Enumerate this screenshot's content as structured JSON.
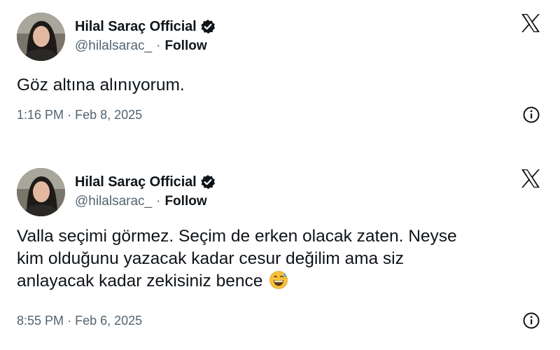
{
  "tweets": [
    {
      "author_name": "Hilal Saraç Official",
      "handle": "@hilalsarac_",
      "separator": "·",
      "follow_label": "Follow",
      "text": "Göz altına alınıyorum.",
      "time": "1:16 PM",
      "date": "Feb 8, 2025"
    },
    {
      "author_name": "Hilal Saraç Official",
      "handle": "@hilalsarac_",
      "separator": "·",
      "follow_label": "Follow",
      "text_line1": "Valla seçimi görmez. Seçim de erken olacak zaten. Neyse",
      "text_line2": "kim olduğunu yazacak kadar cesur değilim ama siz",
      "text_line3": "anlayacak kadar zekisiniz bence",
      "time": "8:55 PM",
      "date": "Feb 6, 2025"
    }
  ],
  "icons": {
    "verified": "verified-badge-icon",
    "brand": "x-logo-icon",
    "info": "info-icon",
    "emoji": "grinning-sweat-emoji"
  },
  "colors": {
    "text": "#0f1419",
    "secondary": "#536471",
    "badge": "#0f1419"
  }
}
